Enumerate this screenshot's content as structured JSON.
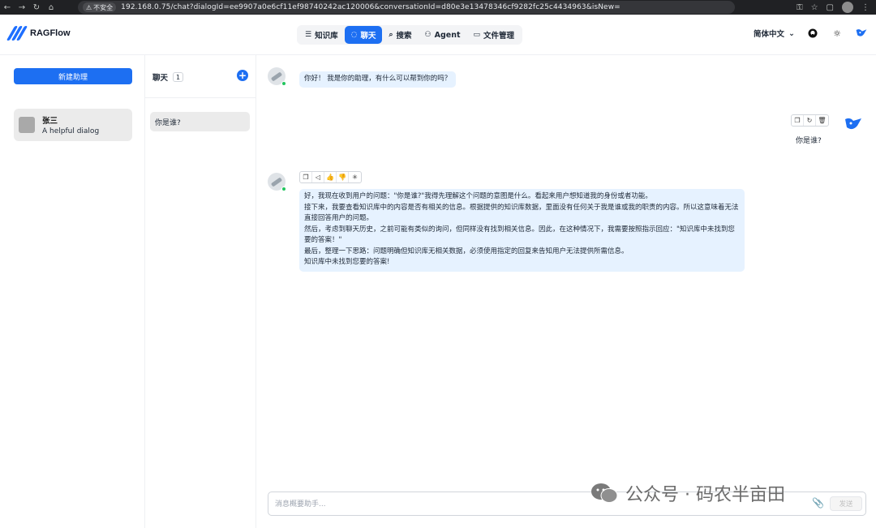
{
  "browser": {
    "insecure_label": "不安全",
    "url": "192.168.0.75/chat?dialogId=ee9907a0e6cf11ef98740242ac120006&conversationId=d80e3e13478346cf9282fc25c4434963&isNew="
  },
  "app": {
    "name": "RAGFlow",
    "nav": [
      {
        "label": "知识库",
        "icon": "database-icon",
        "active": false
      },
      {
        "label": "聊天",
        "icon": "chat-bubble-icon",
        "active": true
      },
      {
        "label": "搜索",
        "icon": "search-icon",
        "active": false
      },
      {
        "label": "Agent",
        "icon": "agent-icon",
        "active": false
      },
      {
        "label": "文件管理",
        "icon": "folder-icon",
        "active": false
      }
    ],
    "language": "简体中文"
  },
  "assistants": {
    "new_button": "新建助理",
    "items": [
      {
        "name": "张三",
        "description": "A helpful dialog"
      }
    ]
  },
  "conversations": {
    "title": "聊天",
    "count": "1",
    "items": [
      {
        "title": "你是谁?"
      }
    ]
  },
  "chat": {
    "greeting": "你好！ 我是你的助理，有什么可以帮到你的吗？",
    "user_message": "你是谁?",
    "answer_lines": [
      "好，我现在收到用户的问题：\"你是谁?\"我得先理解这个问题的意图是什么。看起来用户想知道我的身份或者功能。",
      "接下来，我要查看知识库中的内容是否有相关的信息。根据提供的知识库数据，里面没有任何关于我是谁或我的职责的内容。所以这意味着无法直接回答用户的问题。",
      "然后，考虑到聊天历史，之前可能有类似的询问，但同样没有找到相关信息。因此，在这种情况下，我需要按照指示回应：\"知识库中未找到您要的答案！\"",
      "最后，整理一下思路：问题明确但知识库无相关数据，必须使用指定的回复来告知用户无法提供所需信息。",
      "知识库中未找到您要的答案!"
    ],
    "input_placeholder": "消息概要助手...",
    "send_label": "发送"
  },
  "watermark": {
    "text": "公众号 · 码农半亩田"
  }
}
